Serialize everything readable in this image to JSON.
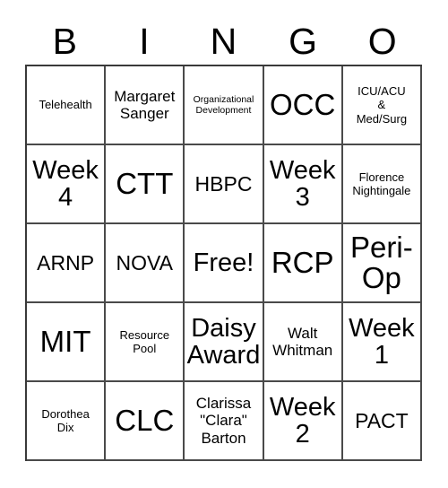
{
  "card": {
    "title": "BINGO",
    "header_letters": [
      "B",
      "I",
      "N",
      "G",
      "O"
    ],
    "columns": 5,
    "rows": 5,
    "free_space": "Free!",
    "colors": {
      "background": "#ffffff",
      "text": "#000000",
      "grid_line": "#4a4a4a"
    },
    "cells": [
      [
        {
          "text": "Telehealth",
          "size": "sm"
        },
        {
          "text": "Margaret\nSanger",
          "size": "md"
        },
        {
          "text": "Organizational\nDevelopment",
          "size": "xs"
        },
        {
          "text": "OCC",
          "size": "xxl"
        },
        {
          "text": "ICU/ACU\n&\nMed/Surg",
          "size": "sm"
        }
      ],
      [
        {
          "text": "Week\n4",
          "size": "xl"
        },
        {
          "text": "CTT",
          "size": "xxl"
        },
        {
          "text": "HBPC",
          "size": "lg"
        },
        {
          "text": "Week\n3",
          "size": "xl"
        },
        {
          "text": "Florence\nNightingale",
          "size": "sm"
        }
      ],
      [
        {
          "text": "ARNP",
          "size": "lg"
        },
        {
          "text": "NOVA",
          "size": "lg"
        },
        {
          "text": "Free!",
          "size": "xl"
        },
        {
          "text": "RCP",
          "size": "xxl"
        },
        {
          "text": "Peri-\nOp",
          "size": "xxl"
        }
      ],
      [
        {
          "text": "MIT",
          "size": "xxl"
        },
        {
          "text": "Resource\nPool",
          "size": "sm"
        },
        {
          "text": "Daisy\nAward",
          "size": "xl"
        },
        {
          "text": "Walt\nWhitman",
          "size": "md"
        },
        {
          "text": "Week\n1",
          "size": "xl"
        }
      ],
      [
        {
          "text": "Dorothea\nDix",
          "size": "sm"
        },
        {
          "text": "CLC",
          "size": "xxl"
        },
        {
          "text": "Clarissa\n\"Clara\"\nBarton",
          "size": "md"
        },
        {
          "text": "Week\n2",
          "size": "xl"
        },
        {
          "text": "PACT",
          "size": "lg"
        }
      ]
    ]
  }
}
